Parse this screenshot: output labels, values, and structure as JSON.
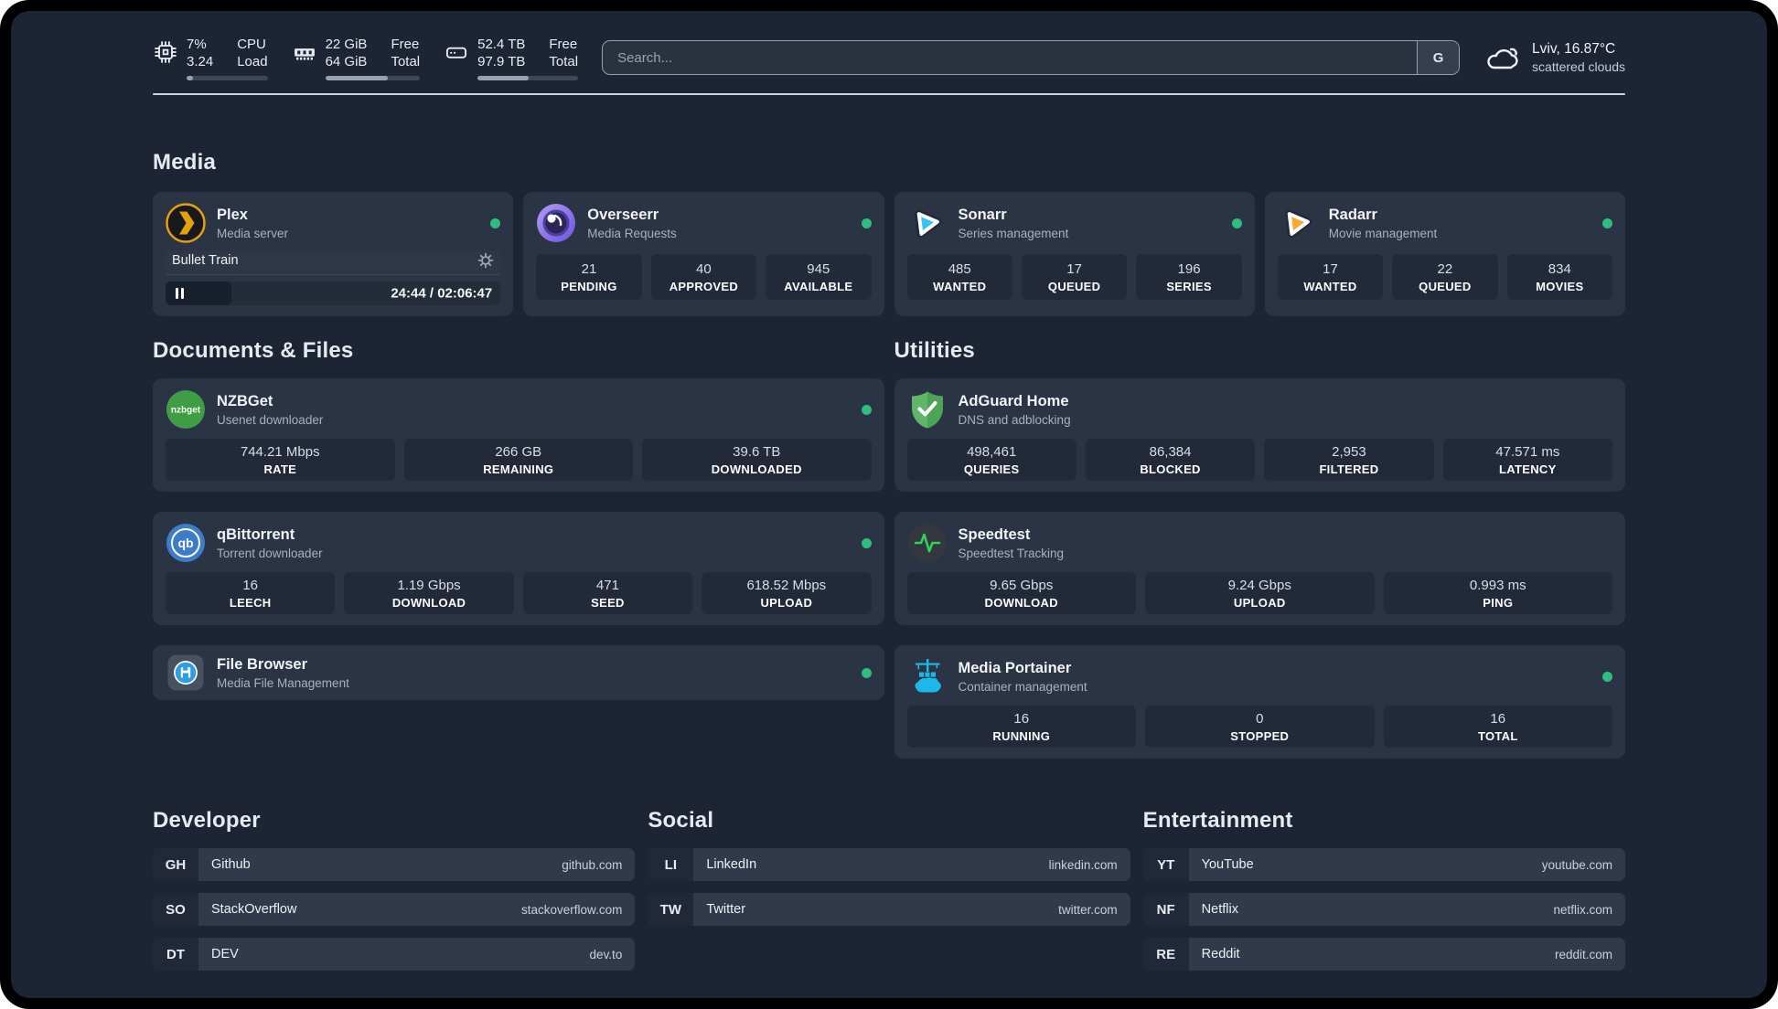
{
  "topbar": {
    "cpu": {
      "value_top": "7%",
      "value_bottom": "3.24",
      "label_top": "CPU",
      "label_bottom": "Load",
      "progress_pct": 8
    },
    "ram": {
      "value_top": "22 GiB",
      "value_bottom": "64 GiB",
      "label_top": "Free",
      "label_bottom": "Total",
      "progress_pct": 66
    },
    "disk": {
      "value_top": "52.4 TB",
      "value_bottom": "97.9 TB",
      "label_top": "Free",
      "label_bottom": "Total",
      "progress_pct": 51
    },
    "search": {
      "placeholder": "Search...",
      "button_label": "G"
    },
    "weather": {
      "headline": "Lviv, 16.87°C",
      "condition": "scattered clouds"
    }
  },
  "sections": {
    "media": "Media",
    "documents": "Documents & Files",
    "utilities": "Utilities",
    "developer": "Developer",
    "social": "Social",
    "entertainment": "Entertainment"
  },
  "apps": {
    "plex": {
      "name": "Plex",
      "subtitle": "Media server",
      "now_playing": "Bullet Train",
      "time": "24:44 / 02:06:47",
      "progress_pct": 19.6
    },
    "overseerr": {
      "name": "Overseerr",
      "subtitle": "Media Requests",
      "stats": [
        {
          "value": "21",
          "label": "PENDING"
        },
        {
          "value": "40",
          "label": "APPROVED"
        },
        {
          "value": "945",
          "label": "AVAILABLE"
        }
      ]
    },
    "sonarr": {
      "name": "Sonarr",
      "subtitle": "Series management",
      "stats": [
        {
          "value": "485",
          "label": "WANTED"
        },
        {
          "value": "17",
          "label": "QUEUED"
        },
        {
          "value": "196",
          "label": "SERIES"
        }
      ]
    },
    "radarr": {
      "name": "Radarr",
      "subtitle": "Movie management",
      "stats": [
        {
          "value": "17",
          "label": "WANTED"
        },
        {
          "value": "22",
          "label": "QUEUED"
        },
        {
          "value": "834",
          "label": "MOVIES"
        }
      ]
    },
    "nzbget": {
      "name": "NZBGet",
      "subtitle": "Usenet downloader",
      "icon_text": "nzbget",
      "stats": [
        {
          "value": "744.21 Mbps",
          "label": "RATE"
        },
        {
          "value": "266 GB",
          "label": "REMAINING"
        },
        {
          "value": "39.6 TB",
          "label": "DOWNLOADED"
        }
      ]
    },
    "qbittorrent": {
      "name": "qBittorrent",
      "subtitle": "Torrent downloader",
      "icon_text": "qb",
      "stats": [
        {
          "value": "16",
          "label": "LEECH"
        },
        {
          "value": "1.19 Gbps",
          "label": "DOWNLOAD"
        },
        {
          "value": "471",
          "label": "SEED"
        },
        {
          "value": "618.52 Mbps",
          "label": "UPLOAD"
        }
      ]
    },
    "filebrowser": {
      "name": "File Browser",
      "subtitle": "Media File Management"
    },
    "adguard": {
      "name": "AdGuard Home",
      "subtitle": "DNS and adblocking",
      "stats": [
        {
          "value": "498,461",
          "label": "QUERIES"
        },
        {
          "value": "86,384",
          "label": "BLOCKED"
        },
        {
          "value": "2,953",
          "label": "FILTERED"
        },
        {
          "value": "47.571 ms",
          "label": "LATENCY"
        }
      ]
    },
    "speedtest": {
      "name": "Speedtest",
      "subtitle": "Speedtest Tracking",
      "stats": [
        {
          "value": "9.65 Gbps",
          "label": "DOWNLOAD"
        },
        {
          "value": "9.24 Gbps",
          "label": "UPLOAD"
        },
        {
          "value": "0.993 ms",
          "label": "PING"
        }
      ]
    },
    "portainer": {
      "name": "Media Portainer",
      "subtitle": "Container management",
      "stats": [
        {
          "value": "16",
          "label": "RUNNING"
        },
        {
          "value": "0",
          "label": "STOPPED"
        },
        {
          "value": "16",
          "label": "TOTAL"
        }
      ]
    }
  },
  "bookmarks": {
    "developer": [
      {
        "abbr": "GH",
        "name": "Github",
        "url": "github.com"
      },
      {
        "abbr": "SO",
        "name": "StackOverflow",
        "url": "stackoverflow.com"
      },
      {
        "abbr": "DT",
        "name": "DEV",
        "url": "dev.to"
      }
    ],
    "social": [
      {
        "abbr": "LI",
        "name": "LinkedIn",
        "url": "linkedin.com"
      },
      {
        "abbr": "TW",
        "name": "Twitter",
        "url": "twitter.com"
      }
    ],
    "entertainment": [
      {
        "abbr": "YT",
        "name": "YouTube",
        "url": "youtube.com"
      },
      {
        "abbr": "NF",
        "name": "Netflix",
        "url": "netflix.com"
      },
      {
        "abbr": "RE",
        "name": "Reddit",
        "url": "reddit.com"
      }
    ]
  },
  "colors": {
    "c-status": "#2ebd7d",
    "c-plex": "#e5a00d",
    "c-sonarr": "#36c3f1",
    "c-radarr": "#f7a82d",
    "c-nzbget": "#3f9e43",
    "c-qbittorrent": "#3d7cc9",
    "c-adguard": "#5fb669",
    "c-speedtest": "#30d158",
    "c-filebrowser": "#2e9fe6",
    "c-portainer": "#1db8e8",
    "c-overseerr": "#7c5ce0"
  }
}
